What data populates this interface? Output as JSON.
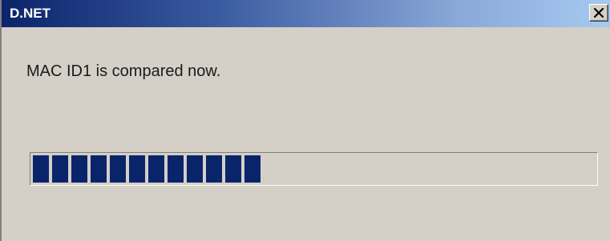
{
  "window": {
    "title": "D.NET",
    "close_label": "Close"
  },
  "message": "MAC ID1 is compared now.",
  "progress": {
    "blocks_filled": 12,
    "blocks_total": 29,
    "fraction": 0.42
  },
  "colors": {
    "titlebar_start": "#0a246a",
    "titlebar_end": "#a6caf0",
    "progress_fill": "#0a246a",
    "dialog_bg": "#d4d0c8"
  },
  "icons": {
    "close": "close-icon"
  }
}
